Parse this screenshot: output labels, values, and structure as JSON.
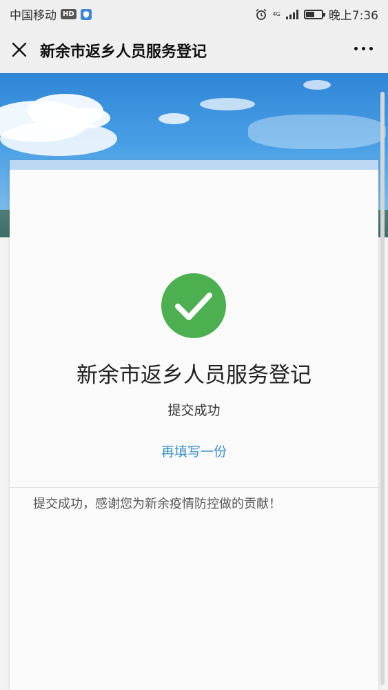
{
  "status_bar": {
    "carrier": "中国移动",
    "hd_badge": "HD",
    "network": "4G",
    "time": "晚上7:36",
    "battery_level": 0.6
  },
  "nav": {
    "title": "新余市返乡人员服务登记"
  },
  "card": {
    "title": "新余市返乡人员服务登记",
    "status_text": "提交成功",
    "refill_link": "再填写一份",
    "thanks_message": "提交成功，感谢您为新余疫情防控做的贡献！"
  },
  "colors": {
    "success_green": "#4caf50",
    "link_blue": "#3a8fc9"
  },
  "icons": {
    "close": "close-icon",
    "more": "more-icon",
    "success": "check-circle-icon",
    "alarm": "alarm-icon"
  }
}
